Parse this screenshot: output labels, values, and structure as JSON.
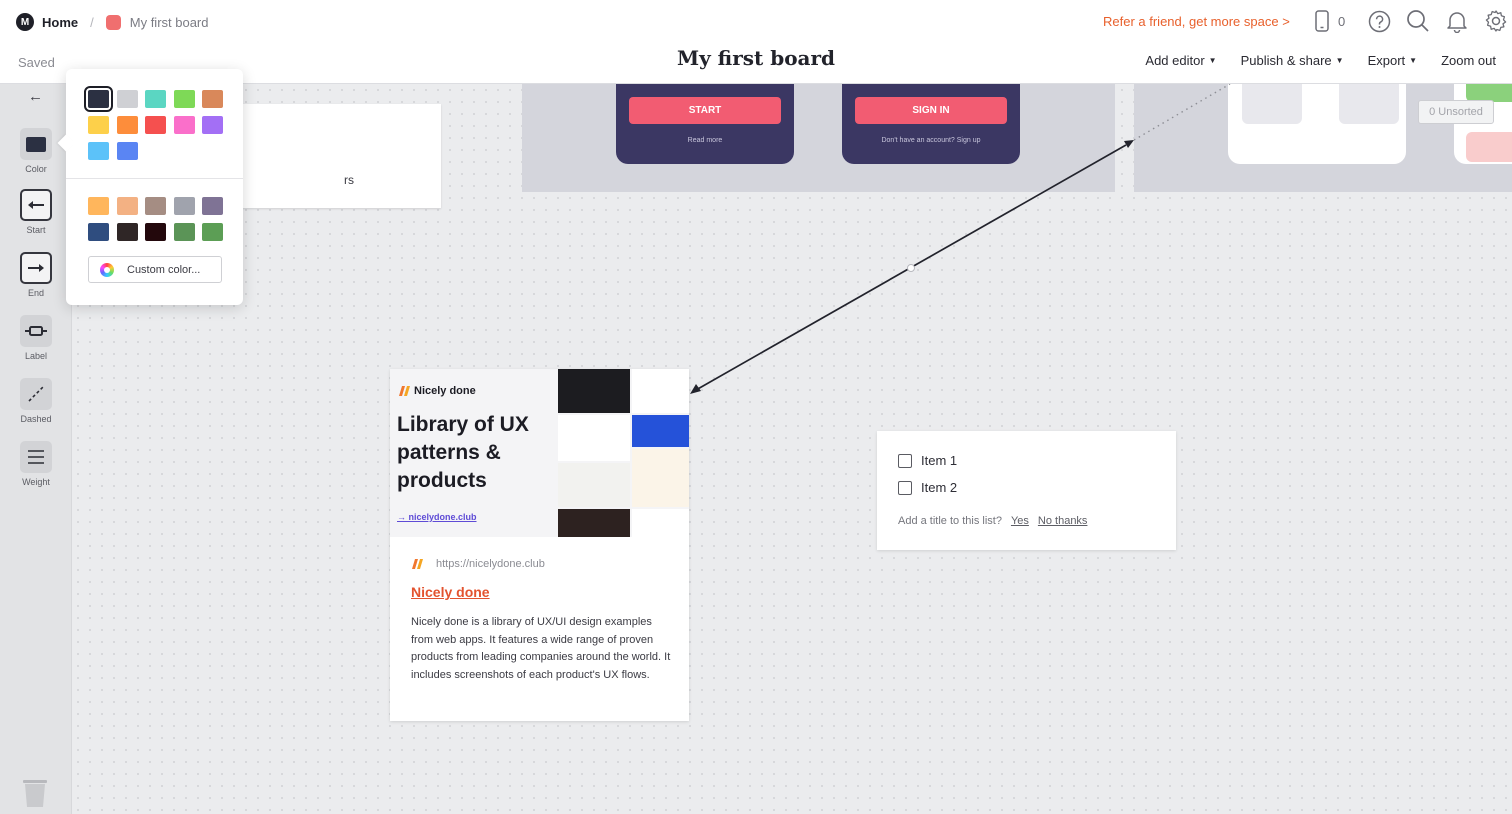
{
  "header": {
    "home_label": "Home",
    "separator": "/",
    "board_label": "My first board",
    "saved_label": "Saved",
    "board_title": "My first board",
    "refer_label": "Refer a friend, get more space >",
    "phone_count": "0",
    "menu": [
      {
        "label": "Add editor"
      },
      {
        "label": "Publish & share"
      },
      {
        "label": "Export"
      },
      {
        "label": "Zoom out"
      }
    ]
  },
  "toolbar": {
    "tools": [
      {
        "label": "Color"
      },
      {
        "label": "Start"
      },
      {
        "label": "End"
      },
      {
        "label": "Label"
      },
      {
        "label": "Dashed"
      },
      {
        "label": "Weight"
      }
    ]
  },
  "color_picker": {
    "primary_colors": [
      "#2b3042",
      "#cfd0d4",
      "#5bd6c2",
      "#7ed957",
      "#d9885a",
      "#fdd04a",
      "#fd8d3b",
      "#f5504f",
      "#fa6fca",
      "#a36ff5",
      "#5cc2f9",
      "#5a85f3"
    ],
    "secondary_colors": [
      "#ffb65c",
      "#f3b183",
      "#a58d83",
      "#a0a3ad",
      "#7f7395",
      "#2f4d7f",
      "#2f2626",
      "#23080c",
      "#5b9457",
      "#5c9e55"
    ],
    "selected_index": 0,
    "custom_label": "Custom color..."
  },
  "canvas": {
    "phone_buttons": [
      {
        "label": "START",
        "sub": "Read more"
      },
      {
        "label": "SIGN IN",
        "sub": "Don't have an account? Sign up"
      }
    ],
    "unsorted_label": "0 Unsorted",
    "note_fragment": "rs",
    "link_card": {
      "brand": "Nicely done",
      "headline": "Library of UX patterns & products",
      "preview_link": "→ nicelydone.club",
      "url": "https://nicelydone.club",
      "title": "Nicely done",
      "description": "Nicely done is a library of UX/UI design examples from web apps. It features a wide range of proven products from leading companies around the world. It includes screenshots of each product's UX flows."
    },
    "todo": {
      "items": [
        "Item 1",
        "Item 2"
      ],
      "prompt": "Add a title to this list?",
      "yes": "Yes",
      "no": "No thanks"
    }
  }
}
